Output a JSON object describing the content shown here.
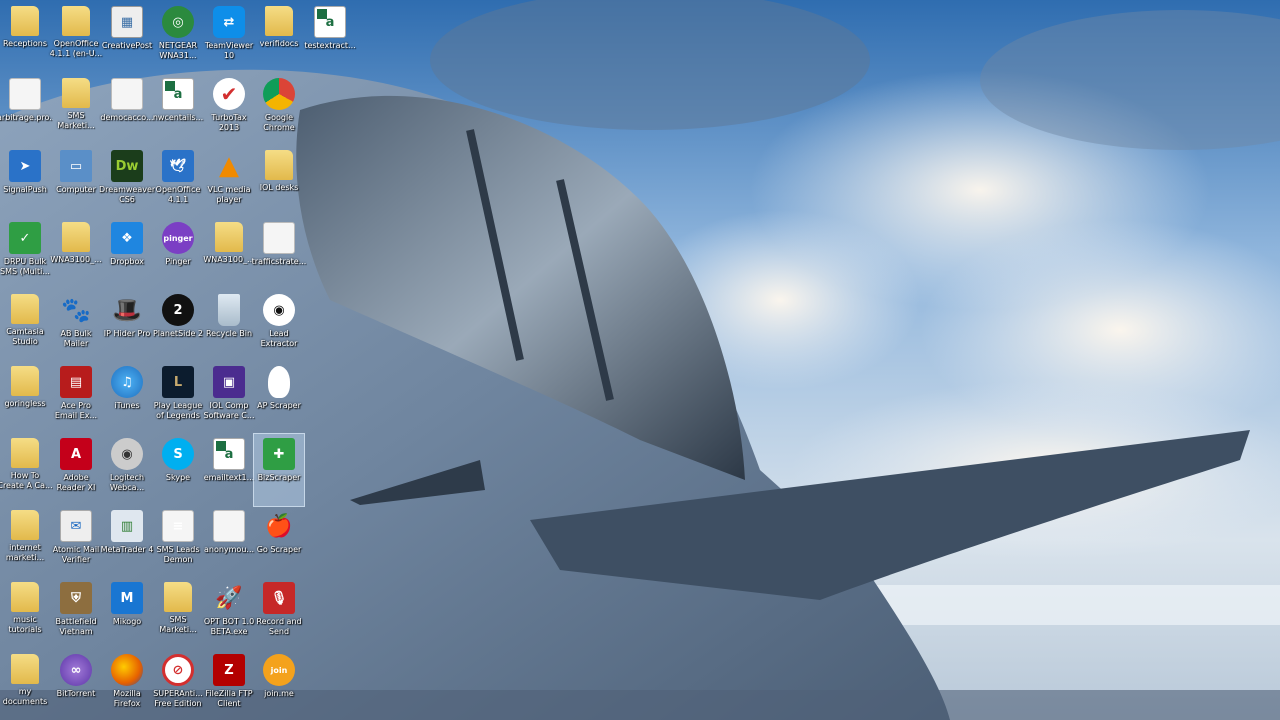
{
  "desktop": {
    "icons": [
      {
        "label": "Receptions",
        "glyph": "folder",
        "text": "",
        "col": 0,
        "row": 0
      },
      {
        "label": "arbitrage.pro...",
        "glyph": "white-sheet",
        "text": "",
        "col": 0,
        "row": 1
      },
      {
        "label": "SignalPush",
        "glyph": "blue",
        "text": "➤",
        "col": 0,
        "row": 2
      },
      {
        "label": "DRPU Bulk\nSMS (Multi...",
        "glyph": "green",
        "text": "✓",
        "col": 0,
        "row": 3
      },
      {
        "label": "Camtasia\nStudio",
        "glyph": "folder",
        "text": "",
        "col": 0,
        "row": 4
      },
      {
        "label": "goringless",
        "glyph": "folder",
        "text": "",
        "col": 0,
        "row": 5
      },
      {
        "label": "How To\nCreate A Ca...",
        "glyph": "folder",
        "text": "",
        "col": 0,
        "row": 6
      },
      {
        "label": "internet\nmarketi...",
        "glyph": "folder",
        "text": "",
        "col": 0,
        "row": 7
      },
      {
        "label": "music\ntutorials",
        "glyph": "folder",
        "text": "",
        "col": 0,
        "row": 8
      },
      {
        "label": "my\ndocuments",
        "glyph": "folder",
        "text": "",
        "col": 0,
        "row": 9
      },
      {
        "label": "OpenOffice\n4.1.1 (en-U...",
        "glyph": "folder",
        "text": "",
        "col": 1,
        "row": 0
      },
      {
        "label": "SMS\nMarketi...",
        "glyph": "folder",
        "text": "",
        "col": 1,
        "row": 1
      },
      {
        "label": "Computer",
        "glyph": "monitor",
        "text": "▭",
        "col": 1,
        "row": 2
      },
      {
        "label": "WNA3100_...",
        "glyph": "folder",
        "text": "",
        "col": 1,
        "row": 3
      },
      {
        "label": "AB Bulk\nMailer",
        "glyph": "paw",
        "text": "🐾",
        "col": 1,
        "row": 4
      },
      {
        "label": "Ace Pro\nEmail Ex...",
        "glyph": "acepro",
        "text": "▤",
        "col": 1,
        "row": 5
      },
      {
        "label": "Adobe\nReader XI",
        "glyph": "adobe",
        "text": "A",
        "col": 1,
        "row": 6
      },
      {
        "label": "Atomic Mail\nVerifier",
        "glyph": "mail",
        "text": "✉",
        "col": 1,
        "row": 7
      },
      {
        "label": "Battlefield\nVietnam",
        "glyph": "battlefield",
        "text": "⛨",
        "col": 1,
        "row": 8
      },
      {
        "label": "BitTorrent",
        "glyph": "bittorrent",
        "text": "∞",
        "col": 1,
        "row": 9
      },
      {
        "label": "CreativePost",
        "glyph": "creative",
        "text": "▦",
        "col": 2,
        "row": 0
      },
      {
        "label": "democacco...",
        "glyph": "white-sheet",
        "text": "",
        "col": 2,
        "row": 1
      },
      {
        "label": "Dreamweaver\nCS6",
        "glyph": "dw",
        "text": "Dw",
        "col": 2,
        "row": 2
      },
      {
        "label": "Dropbox",
        "glyph": "dropbox",
        "text": "❖",
        "col": 2,
        "row": 3
      },
      {
        "label": "IP Hider Pro",
        "glyph": "hat",
        "text": "🎩",
        "col": 2,
        "row": 4
      },
      {
        "label": "iTunes",
        "glyph": "itunes",
        "text": "♫",
        "col": 2,
        "row": 5
      },
      {
        "label": "Logitech\nWebca...",
        "glyph": "webcam",
        "text": "◉",
        "col": 2,
        "row": 6
      },
      {
        "label": "MetaTrader 4",
        "glyph": "meta",
        "text": "▥",
        "col": 2,
        "row": 7
      },
      {
        "label": "Mikogo",
        "glyph": "mikogo",
        "text": "M",
        "col": 2,
        "row": 8
      },
      {
        "label": "Mozilla\nFirefox",
        "glyph": "firefox",
        "text": "",
        "col": 2,
        "row": 9
      },
      {
        "label": "NETGEAR\nWNA31...",
        "glyph": "netgear",
        "text": "◎",
        "col": 3,
        "row": 0
      },
      {
        "label": "nwcentails...",
        "glyph": "excel",
        "text": "a",
        "col": 3,
        "row": 1
      },
      {
        "label": "OpenOffice\n4.1.1",
        "glyph": "blue",
        "text": "🕊",
        "col": 3,
        "row": 2
      },
      {
        "label": "Pinger",
        "glyph": "pinger",
        "text": "pinger",
        "col": 3,
        "row": 3
      },
      {
        "label": "PlanetSide 2",
        "glyph": "ps2",
        "text": "2",
        "col": 3,
        "row": 4
      },
      {
        "label": "Play League\nof Legends",
        "glyph": "league",
        "text": "L",
        "col": 3,
        "row": 5
      },
      {
        "label": "Skype",
        "glyph": "skype",
        "text": "S",
        "col": 3,
        "row": 6
      },
      {
        "label": "SMS Leads\nDemon",
        "glyph": "white-sheet",
        "text": "≡",
        "col": 3,
        "row": 7
      },
      {
        "label": "SMS\nMarketi...",
        "glyph": "folder",
        "text": "",
        "col": 3,
        "row": 8
      },
      {
        "label": "SUPERAnti...\nFree Edition",
        "glyph": "ban",
        "text": "⊘",
        "col": 3,
        "row": 9
      },
      {
        "label": "TeamViewer\n10",
        "glyph": "teamviewer",
        "text": "⇄",
        "col": 4,
        "row": 0
      },
      {
        "label": "TurboTax\n2013",
        "glyph": "tt",
        "text": "✔",
        "col": 4,
        "row": 1
      },
      {
        "label": "VLC media\nplayer",
        "glyph": "vlc",
        "text": "▲",
        "col": 4,
        "row": 2
      },
      {
        "label": "WNA3100_...",
        "glyph": "folder",
        "text": "",
        "col": 4,
        "row": 3
      },
      {
        "label": "Recycle Bin",
        "glyph": "recycle",
        "text": "",
        "col": 4,
        "row": 4
      },
      {
        "label": "IOL Comp\nSoftware C...",
        "glyph": "purple",
        "text": "▣",
        "col": 4,
        "row": 5
      },
      {
        "label": "emailtext1...",
        "glyph": "excel",
        "text": "a",
        "col": 4,
        "row": 6
      },
      {
        "label": "anonymou...",
        "glyph": "white-sheet",
        "text": "",
        "col": 4,
        "row": 7
      },
      {
        "label": "OPT BOT 1.0\nBETA.exe",
        "glyph": "rocket",
        "text": "🚀",
        "col": 4,
        "row": 8
      },
      {
        "label": "FileZilla FTP\nClient",
        "glyph": "filezilla",
        "text": "Z",
        "col": 4,
        "row": 9
      },
      {
        "label": "verifidocs",
        "glyph": "folder",
        "text": "",
        "col": 5,
        "row": 0
      },
      {
        "label": "Google\nChrome",
        "glyph": "chrome",
        "text": "",
        "col": 5,
        "row": 1
      },
      {
        "label": "IOL desks",
        "glyph": "folder",
        "text": "",
        "col": 5,
        "row": 2
      },
      {
        "label": "trafficstrate...",
        "glyph": "white-sheet",
        "text": "",
        "col": 5,
        "row": 3
      },
      {
        "label": "Lead\nExtractor",
        "glyph": "eye",
        "text": "◉",
        "col": 5,
        "row": 4
      },
      {
        "label": "AP Scraper",
        "glyph": "lightbulb",
        "text": "",
        "col": 5,
        "row": 5
      },
      {
        "label": "BizScraper",
        "glyph": "green",
        "text": "✚",
        "col": 5,
        "row": 6,
        "selected": true
      },
      {
        "label": "Go Scraper",
        "glyph": "apple",
        "text": "🍎",
        "col": 5,
        "row": 7
      },
      {
        "label": "Record and\nSend",
        "glyph": "mic",
        "text": "🎙",
        "col": 5,
        "row": 8
      },
      {
        "label": "join.me",
        "glyph": "joinme",
        "text": "join",
        "col": 5,
        "row": 9
      },
      {
        "label": "testextract...",
        "glyph": "excel",
        "text": "a",
        "col": 6,
        "row": 0
      }
    ]
  }
}
